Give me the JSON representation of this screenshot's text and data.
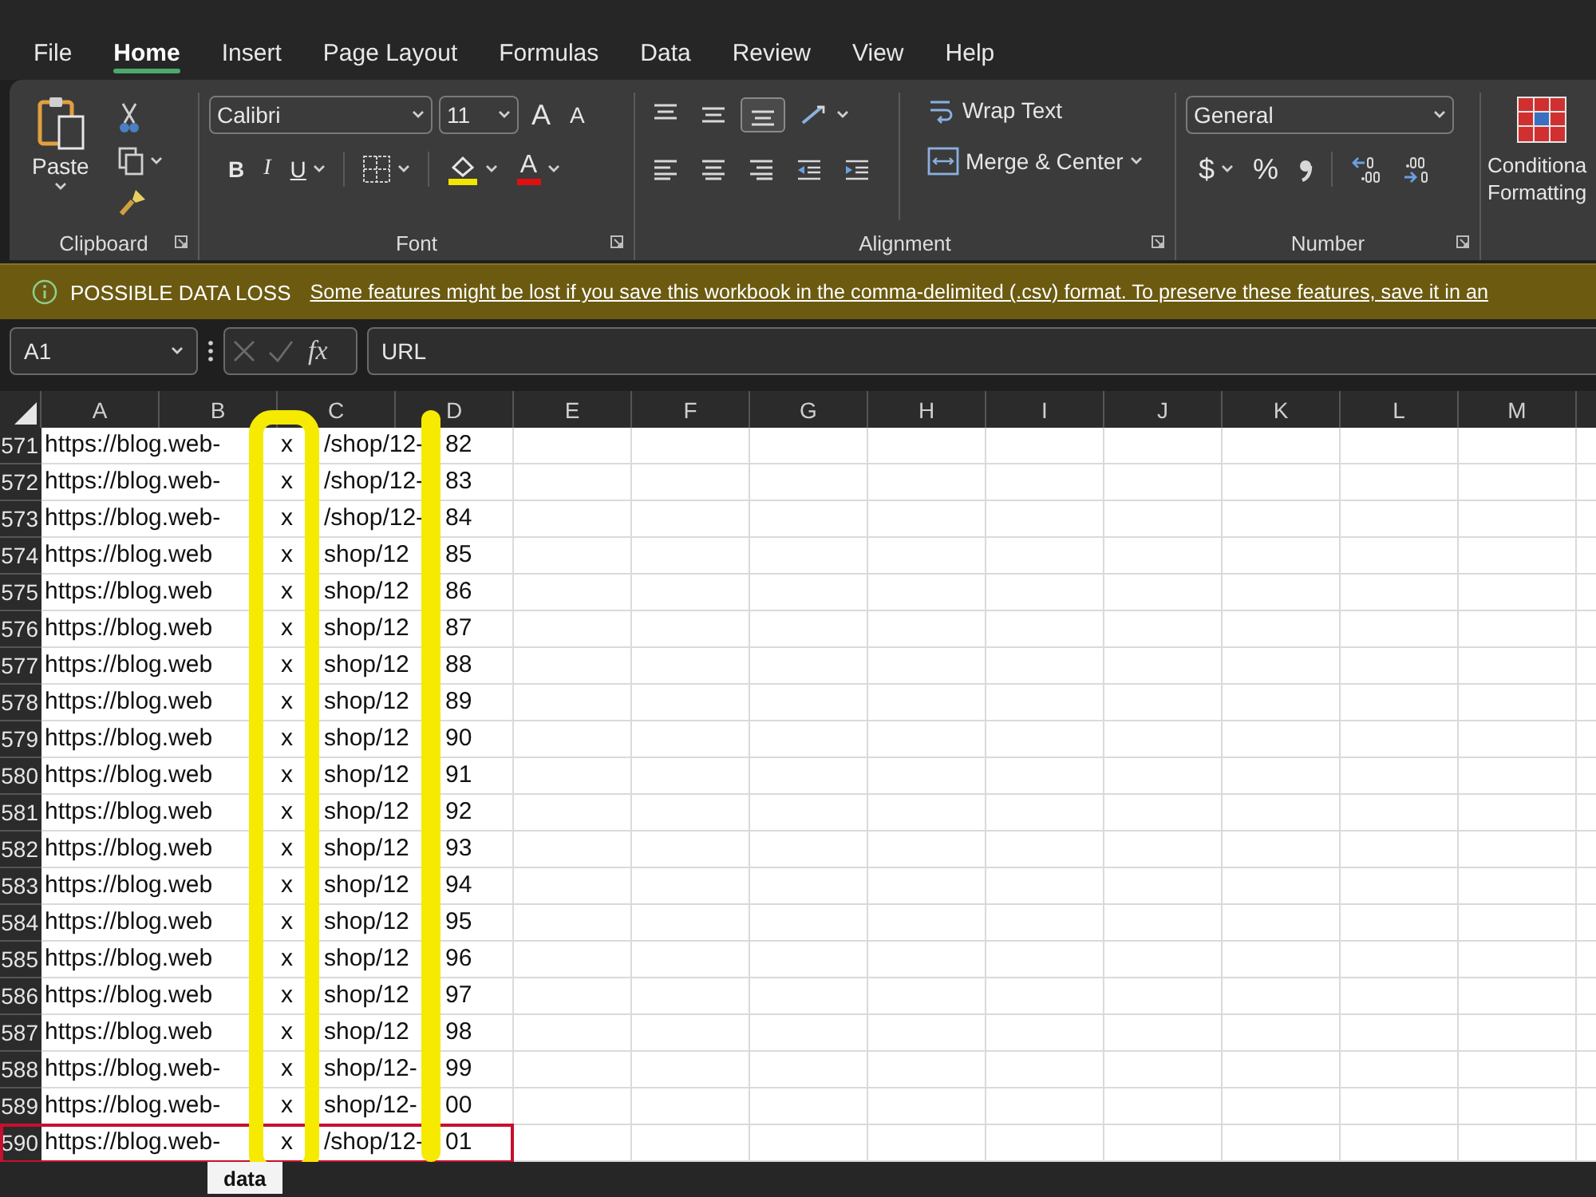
{
  "menu": [
    {
      "label": "File",
      "selected": false
    },
    {
      "label": "Home",
      "selected": true
    },
    {
      "label": "Insert",
      "selected": false
    },
    {
      "label": "Page Layout",
      "selected": false
    },
    {
      "label": "Formulas",
      "selected": false
    },
    {
      "label": "Data",
      "selected": false
    },
    {
      "label": "Review",
      "selected": false
    },
    {
      "label": "View",
      "selected": false
    },
    {
      "label": "Help",
      "selected": false
    }
  ],
  "ribbon": {
    "clipboard": {
      "paste": "Paste",
      "label": "Clipboard"
    },
    "font": {
      "name": "Calibri",
      "size": "11",
      "grow": "A",
      "shrink": "A",
      "bold": "B",
      "italic": "I",
      "underline": "U",
      "font_color": "A",
      "label": "Font"
    },
    "alignment": {
      "wrap": "Wrap Text",
      "merge": "Merge & Center",
      "label": "Alignment"
    },
    "number": {
      "format": "General",
      "currency": "$",
      "percent": "%",
      "label": "Number"
    },
    "conditional": [
      "Conditiona",
      "Formatting"
    ]
  },
  "message": {
    "title": "POSSIBLE DATA LOSS",
    "text": "Some features might be lost if you save this workbook in the comma-delimited (.csv) format. To preserve these features, save it in an"
  },
  "formula_bar": {
    "name_box": "A1",
    "fx": "fx",
    "value": "URL"
  },
  "columns": [
    "A",
    "B",
    "C",
    "D",
    "E",
    "F",
    "G",
    "H",
    "I",
    "J",
    "K",
    "L",
    "M"
  ],
  "rows": [
    {
      "number": "571",
      "url_start": "https://blog.web-",
      "url_mid": "x",
      "url_path": "/shop/12-",
      "url_end": "82",
      "boxed": false
    },
    {
      "number": "572",
      "url_start": "https://blog.web-",
      "url_mid": "x",
      "url_path": "/shop/12-",
      "url_end": "83",
      "boxed": false
    },
    {
      "number": "573",
      "url_start": "https://blog.web-",
      "url_mid": "x",
      "url_path": "/shop/12-",
      "url_end": "84",
      "boxed": false
    },
    {
      "number": "574",
      "url_start": "https://blog.web",
      "url_mid": "x",
      "url_path": "shop/12",
      "url_end": "85",
      "boxed": false
    },
    {
      "number": "575",
      "url_start": "https://blog.web",
      "url_mid": "x",
      "url_path": "shop/12",
      "url_end": "86",
      "boxed": false
    },
    {
      "number": "576",
      "url_start": "https://blog.web",
      "url_mid": "x",
      "url_path": "shop/12",
      "url_end": "87",
      "boxed": false
    },
    {
      "number": "577",
      "url_start": "https://blog.web",
      "url_mid": "x",
      "url_path": "shop/12",
      "url_end": "88",
      "boxed": false
    },
    {
      "number": "578",
      "url_start": "https://blog.web",
      "url_mid": "x",
      "url_path": "shop/12",
      "url_end": "89",
      "boxed": false
    },
    {
      "number": "579",
      "url_start": "https://blog.web",
      "url_mid": "x",
      "url_path": "shop/12",
      "url_end": "90",
      "boxed": false
    },
    {
      "number": "580",
      "url_start": "https://blog.web",
      "url_mid": "x",
      "url_path": "shop/12",
      "url_end": "91",
      "boxed": false
    },
    {
      "number": "581",
      "url_start": "https://blog.web",
      "url_mid": "x",
      "url_path": "shop/12",
      "url_end": "92",
      "boxed": false
    },
    {
      "number": "582",
      "url_start": "https://blog.web",
      "url_mid": "x",
      "url_path": "shop/12",
      "url_end": "93",
      "boxed": false
    },
    {
      "number": "583",
      "url_start": "https://blog.web",
      "url_mid": "x",
      "url_path": "shop/12",
      "url_end": "94",
      "boxed": false
    },
    {
      "number": "584",
      "url_start": "https://blog.web",
      "url_mid": "x",
      "url_path": "shop/12",
      "url_end": "95",
      "boxed": false
    },
    {
      "number": "585",
      "url_start": "https://blog.web",
      "url_mid": "x",
      "url_path": "shop/12",
      "url_end": "96",
      "boxed": false
    },
    {
      "number": "586",
      "url_start": "https://blog.web",
      "url_mid": "x",
      "url_path": "shop/12",
      "url_end": "97",
      "boxed": false
    },
    {
      "number": "587",
      "url_start": "https://blog.web",
      "url_mid": "x",
      "url_path": "shop/12",
      "url_end": "98",
      "boxed": false
    },
    {
      "number": "588",
      "url_start": "https://blog.web-",
      "url_mid": "x",
      "url_path": "shop/12-",
      "url_end": "99",
      "boxed": false
    },
    {
      "number": "589",
      "url_start": "https://blog.web-",
      "url_mid": "x",
      "url_path": "shop/12-",
      "url_end": "00",
      "boxed": false
    },
    {
      "number": "590",
      "url_start": "https://blog.web-",
      "url_mid": "x",
      "url_path": "/shop/12-",
      "url_end": "01",
      "boxed": true
    }
  ],
  "annotations": [
    {
      "kind": "loop"
    },
    {
      "kind": "bar"
    }
  ],
  "sheet_tabs": [
    {
      "label": "data",
      "selected": true
    }
  ]
}
